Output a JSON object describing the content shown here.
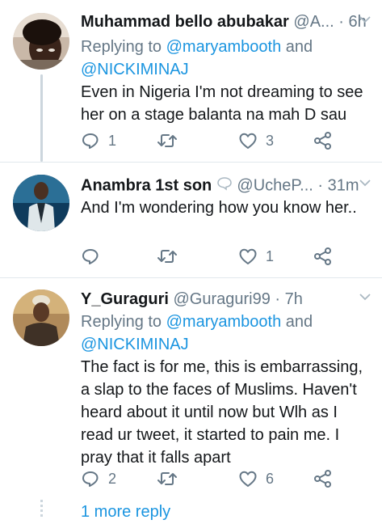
{
  "tweets": [
    {
      "name": "Muhammad bello abubakar",
      "handle": "@A...",
      "sep": "·",
      "time": "6h",
      "replying_prefix": "Replying to ",
      "replying_user1": "@maryambooth",
      "replying_and": " and",
      "replying_user2": "@NICKIMINAJ",
      "text": "Even in Nigeria I'm not dreaming to see her on a stage balanta na mah D sau",
      "replies": "1",
      "retweets": "",
      "likes": "3"
    },
    {
      "name": "Anambra 1st son",
      "emoji_icon": "speech-bubble-icon",
      "handle": "@UcheP...",
      "sep": "·",
      "time": "31m",
      "text": "And I'm wondering how you know her..",
      "replies": "",
      "retweets": "",
      "likes": "1"
    },
    {
      "name": "Y_Guraguri",
      "handle": "@Guraguri99",
      "sep": "·",
      "time": "7h",
      "replying_prefix": "Replying to ",
      "replying_user1": "@maryambooth",
      "replying_and": " and",
      "replying_user2": "@NICKIMINAJ",
      "text": "The fact is for me, this is embarrassing, a slap to the faces of Muslims. Haven't heard about it until now but Wlh as I read ur tweet, it started to pain me. I pray that it falls apart",
      "replies": "2",
      "retweets": "",
      "likes": "6"
    }
  ],
  "more_reply": "1 more reply",
  "colors": {
    "accent": "#1b95e0",
    "secondary": "#657786",
    "divider": "#e1e8ed"
  }
}
